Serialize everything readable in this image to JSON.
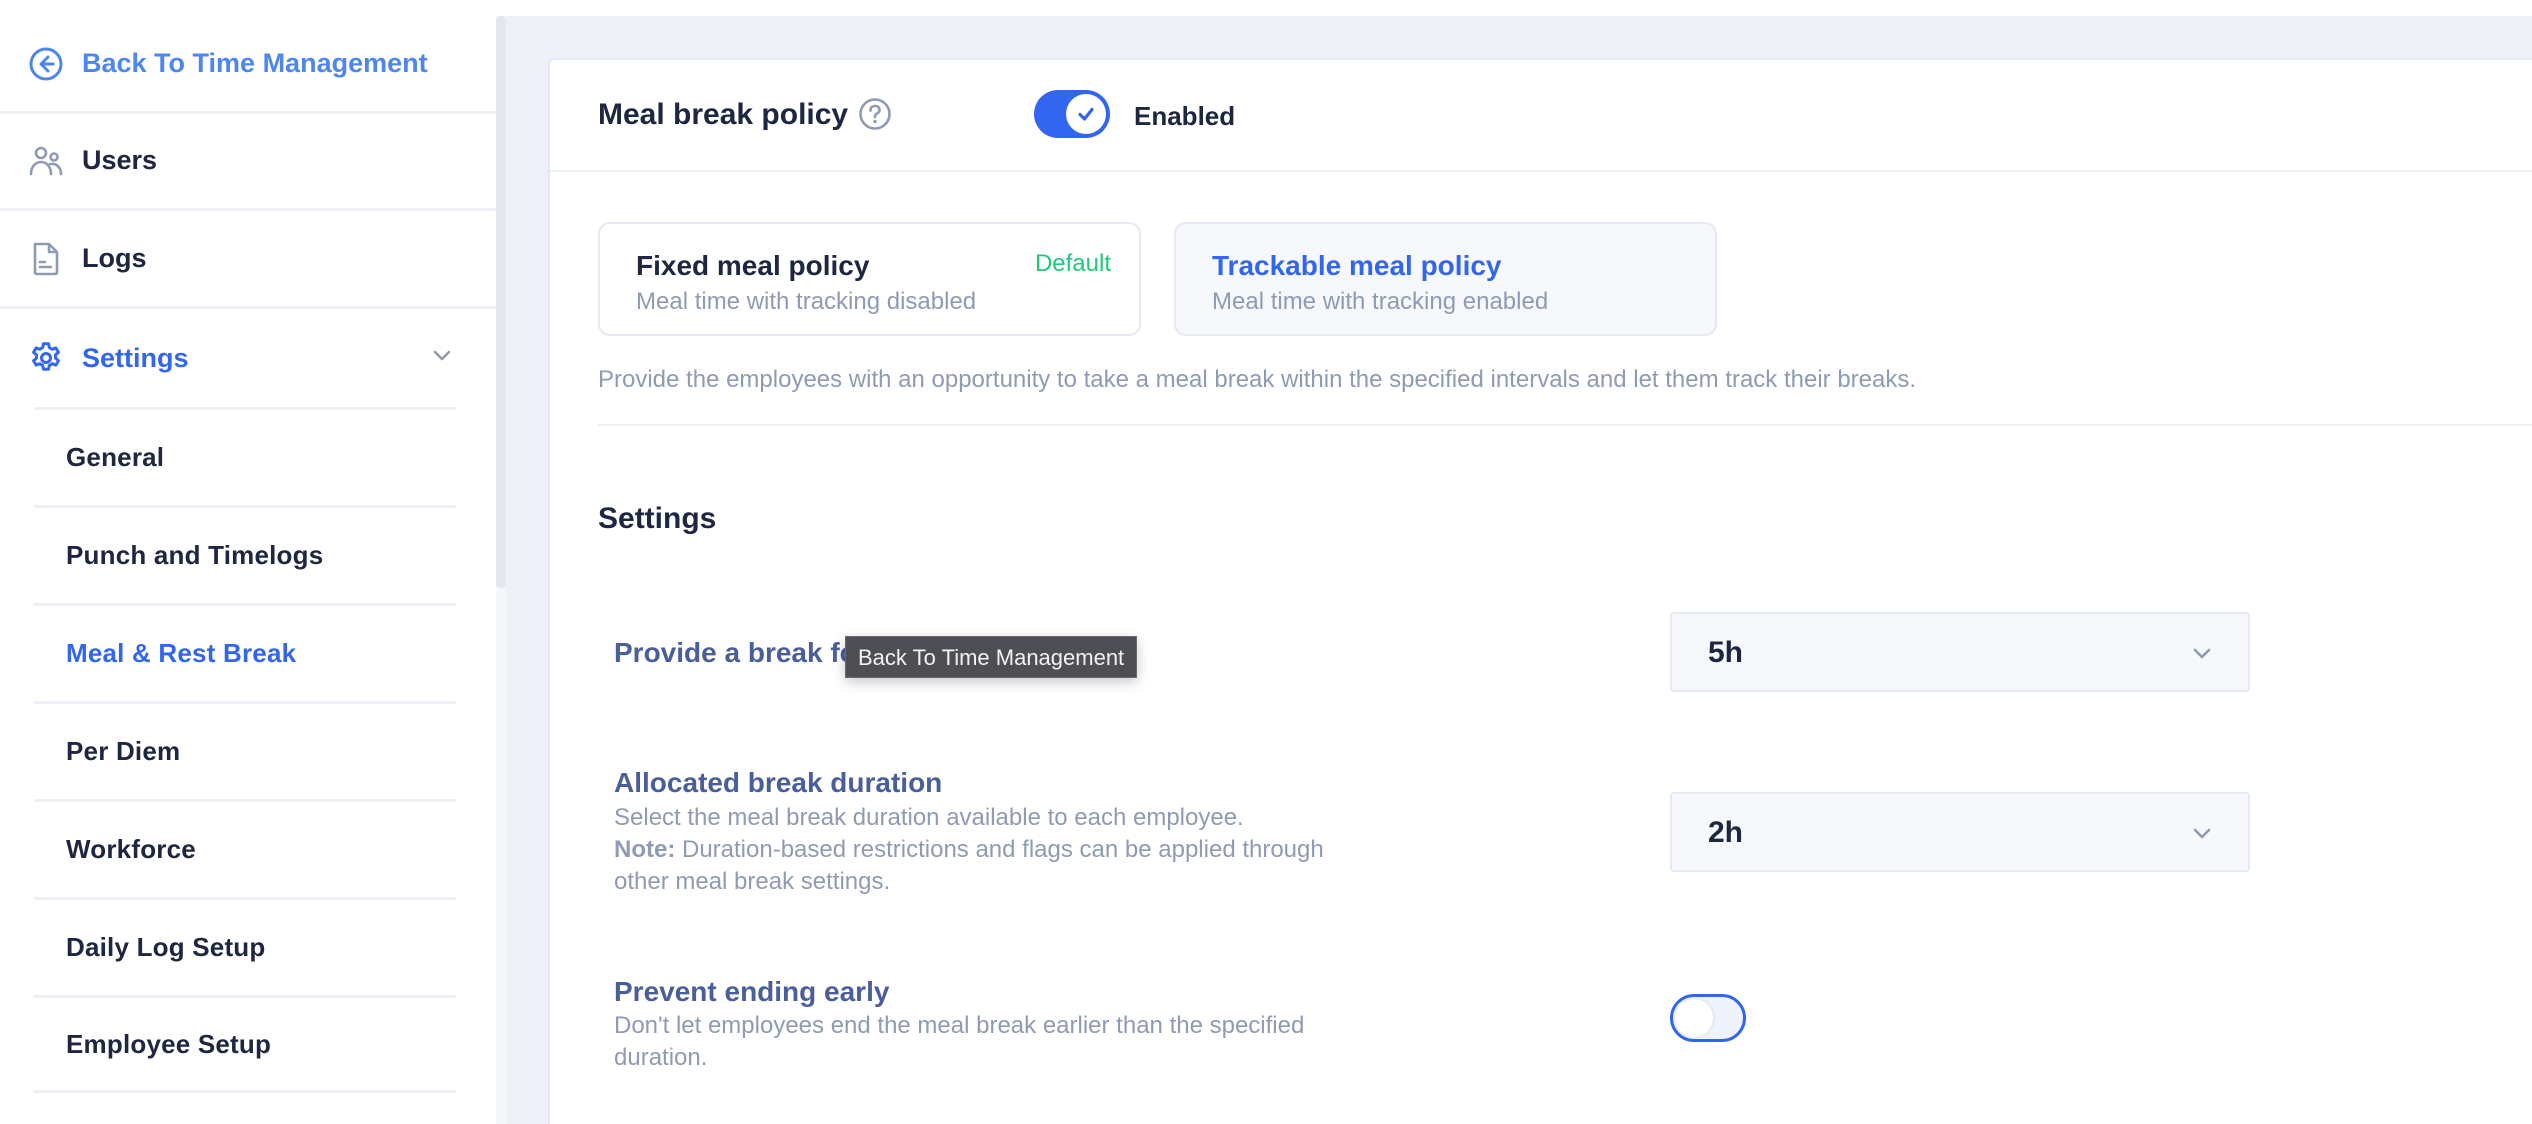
{
  "sidebar": {
    "back_label": "Back To Time Management",
    "items": [
      {
        "label": "Users",
        "icon": "users-icon"
      },
      {
        "label": "Logs",
        "icon": "document-icon"
      },
      {
        "label": "Settings",
        "icon": "gear-icon",
        "expanded": true
      }
    ],
    "settings_subitems": [
      {
        "label": "General",
        "active": false
      },
      {
        "label": "Punch and Timelogs",
        "active": false
      },
      {
        "label": "Meal & Rest Break",
        "active": true
      },
      {
        "label": "Per Diem",
        "active": false
      },
      {
        "label": "Workforce",
        "active": false
      },
      {
        "label": "Daily Log Setup",
        "active": false
      },
      {
        "label": "Employee Setup",
        "active": false
      }
    ]
  },
  "main": {
    "policy_title": "Meal break policy",
    "policy_enabled": true,
    "policy_toggle_label": "Enabled",
    "policy_options": [
      {
        "title": "Fixed meal policy",
        "subtitle": "Meal time with tracking disabled",
        "badge": "Default",
        "selected": false
      },
      {
        "title": "Trackable meal policy",
        "subtitle": "Meal time with tracking enabled",
        "selected": true
      }
    ],
    "policy_description": "Provide the employees with an opportunity to take a meal break within the specified intervals and let them track their breaks.",
    "settings_heading": "Settings",
    "rows": [
      {
        "label": "Provide a break fo",
        "select_value": "5h"
      },
      {
        "label": "Allocated break duration",
        "description": "Select the meal break duration available to each employee.",
        "note_label": "Note:",
        "note_text": " Duration-based restrictions and flags can be applied through other meal break settings.",
        "select_value": "2h"
      },
      {
        "label": "Prevent ending early",
        "description": "Don't let employees end the meal break earlier than the specified duration.",
        "toggle_on": false
      }
    ]
  },
  "tooltip": {
    "text": "Back To Time Management"
  },
  "colors": {
    "accent": "#3366f0",
    "back_link": "#4e86ef",
    "default_badge": "#1ec97a",
    "label": "#4a5f9a",
    "muted": "#8f9bb3",
    "page_bg": "#edf0f7"
  }
}
